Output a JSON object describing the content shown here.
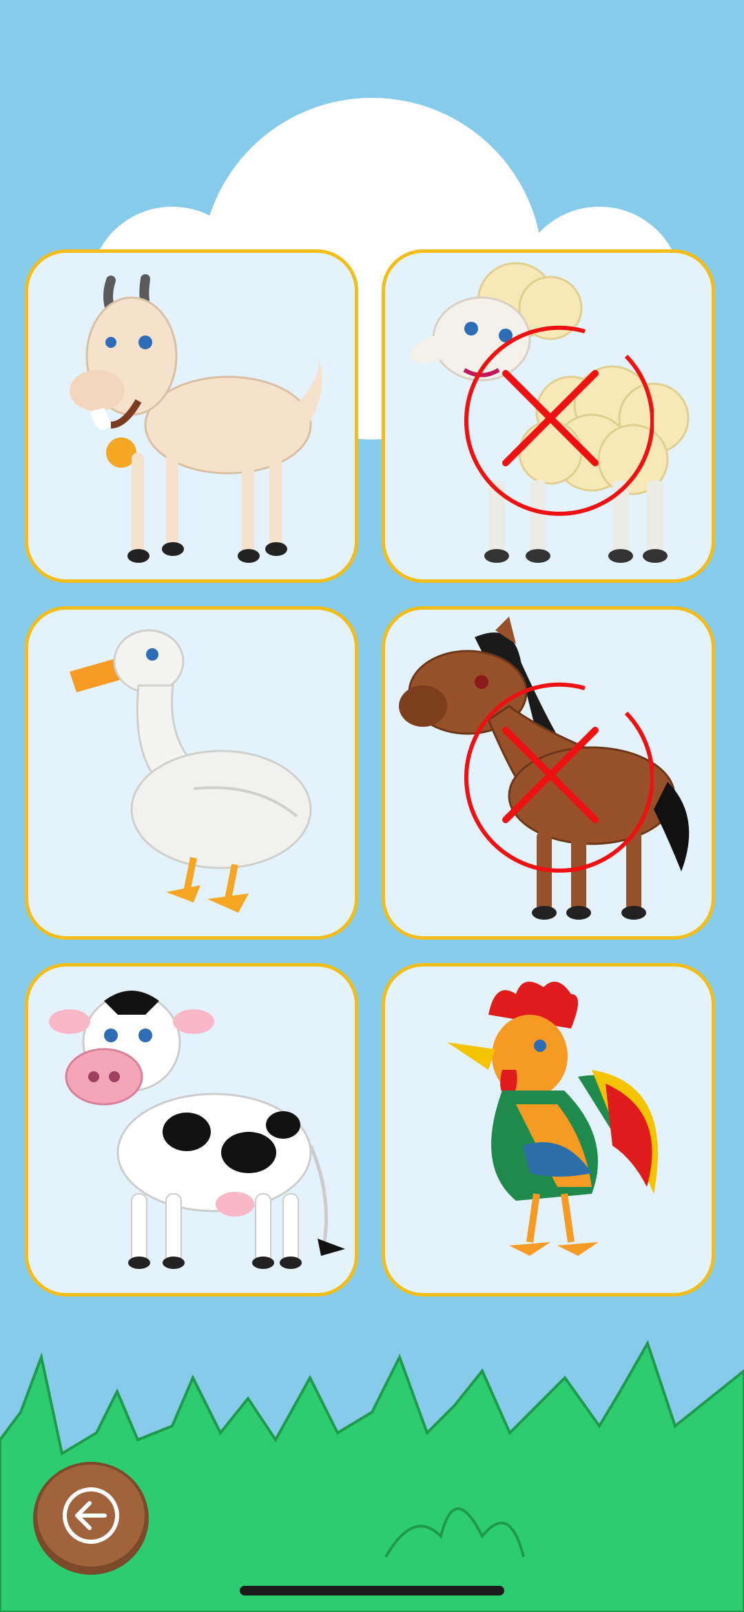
{
  "game": {
    "cards": [
      {
        "animal": "goat",
        "icon": "goat-icon",
        "state": "normal"
      },
      {
        "animal": "sheep",
        "icon": "sheep-icon",
        "state": "wrong"
      },
      {
        "animal": "goose",
        "icon": "goose-icon",
        "state": "normal"
      },
      {
        "animal": "horse",
        "icon": "horse-icon",
        "state": "wrong"
      },
      {
        "animal": "cow",
        "icon": "cow-icon",
        "state": "normal"
      },
      {
        "animal": "rooster",
        "icon": "rooster-icon",
        "state": "normal"
      }
    ],
    "wrong_mark_icon": "circle-x-icon",
    "back_button_icon": "back-arrow-icon"
  },
  "colors": {
    "sky": "#86cbea",
    "card_border": "#f2bd18",
    "card_fill": "#e4f3fb",
    "wrong_mark": "#ee1111",
    "grass": "#2ecc71",
    "grass_outline": "#1e9a4a",
    "wood": "#a0633c"
  }
}
